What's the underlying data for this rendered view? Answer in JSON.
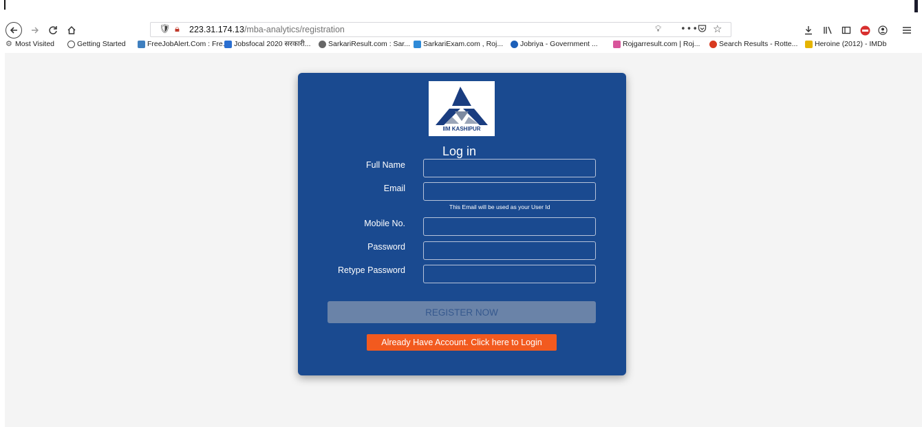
{
  "browser": {
    "url_host": "223.31.174.13",
    "url_path": "/mba-analytics/registration",
    "bookmarks": [
      {
        "label": "Most Visited",
        "icon": "gear-icon",
        "color": "#555555"
      },
      {
        "label": "Getting Started",
        "icon": "globe-icon",
        "color": "#444444"
      },
      {
        "label": "FreeJobAlert.Com : Fre...",
        "icon": "freejobalert-icon",
        "color": "#3f7fbf"
      },
      {
        "label": "Jobsfocal 2020 सरकारी...",
        "icon": "jobsfocal-icon",
        "color": "#2a6fd1"
      },
      {
        "label": "SarkariResult.com : Sar...",
        "icon": "sarkariresult-icon",
        "color": "#555555"
      },
      {
        "label": "SarkariExam.com , Roj...",
        "icon": "sarkariexam-icon",
        "color": "#2e8ad8"
      },
      {
        "label": "Jobriya - Government ...",
        "icon": "jobriya-icon",
        "color": "#1c5fb8"
      },
      {
        "label": "Rojgarresult.com | Roj...",
        "icon": "rojgarresult-icon",
        "color": "#d8559b"
      },
      {
        "label": "Search Results - Rotte...",
        "icon": "tomato-icon",
        "color": "#d8391f"
      },
      {
        "label": "Heroine (2012) - IMDb",
        "icon": "imdb-icon",
        "color": "#e5b400"
      }
    ]
  },
  "form": {
    "logo_text": "IIM KASHIPUR",
    "title": "Log in",
    "full_name_label": "Full Name",
    "email_label": "Email",
    "email_hint": "This Email will be used as your User Id",
    "mobile_label": "Mobile No.",
    "password_label": "Password",
    "retype_label": "Retype Password",
    "register_label": "REGISTER NOW",
    "login_link_label": "Already Have Account. Click here to Login"
  },
  "colors": {
    "card": "#1a4a90",
    "register_button": "#6a83a8",
    "login_button": "#f25a1f"
  }
}
